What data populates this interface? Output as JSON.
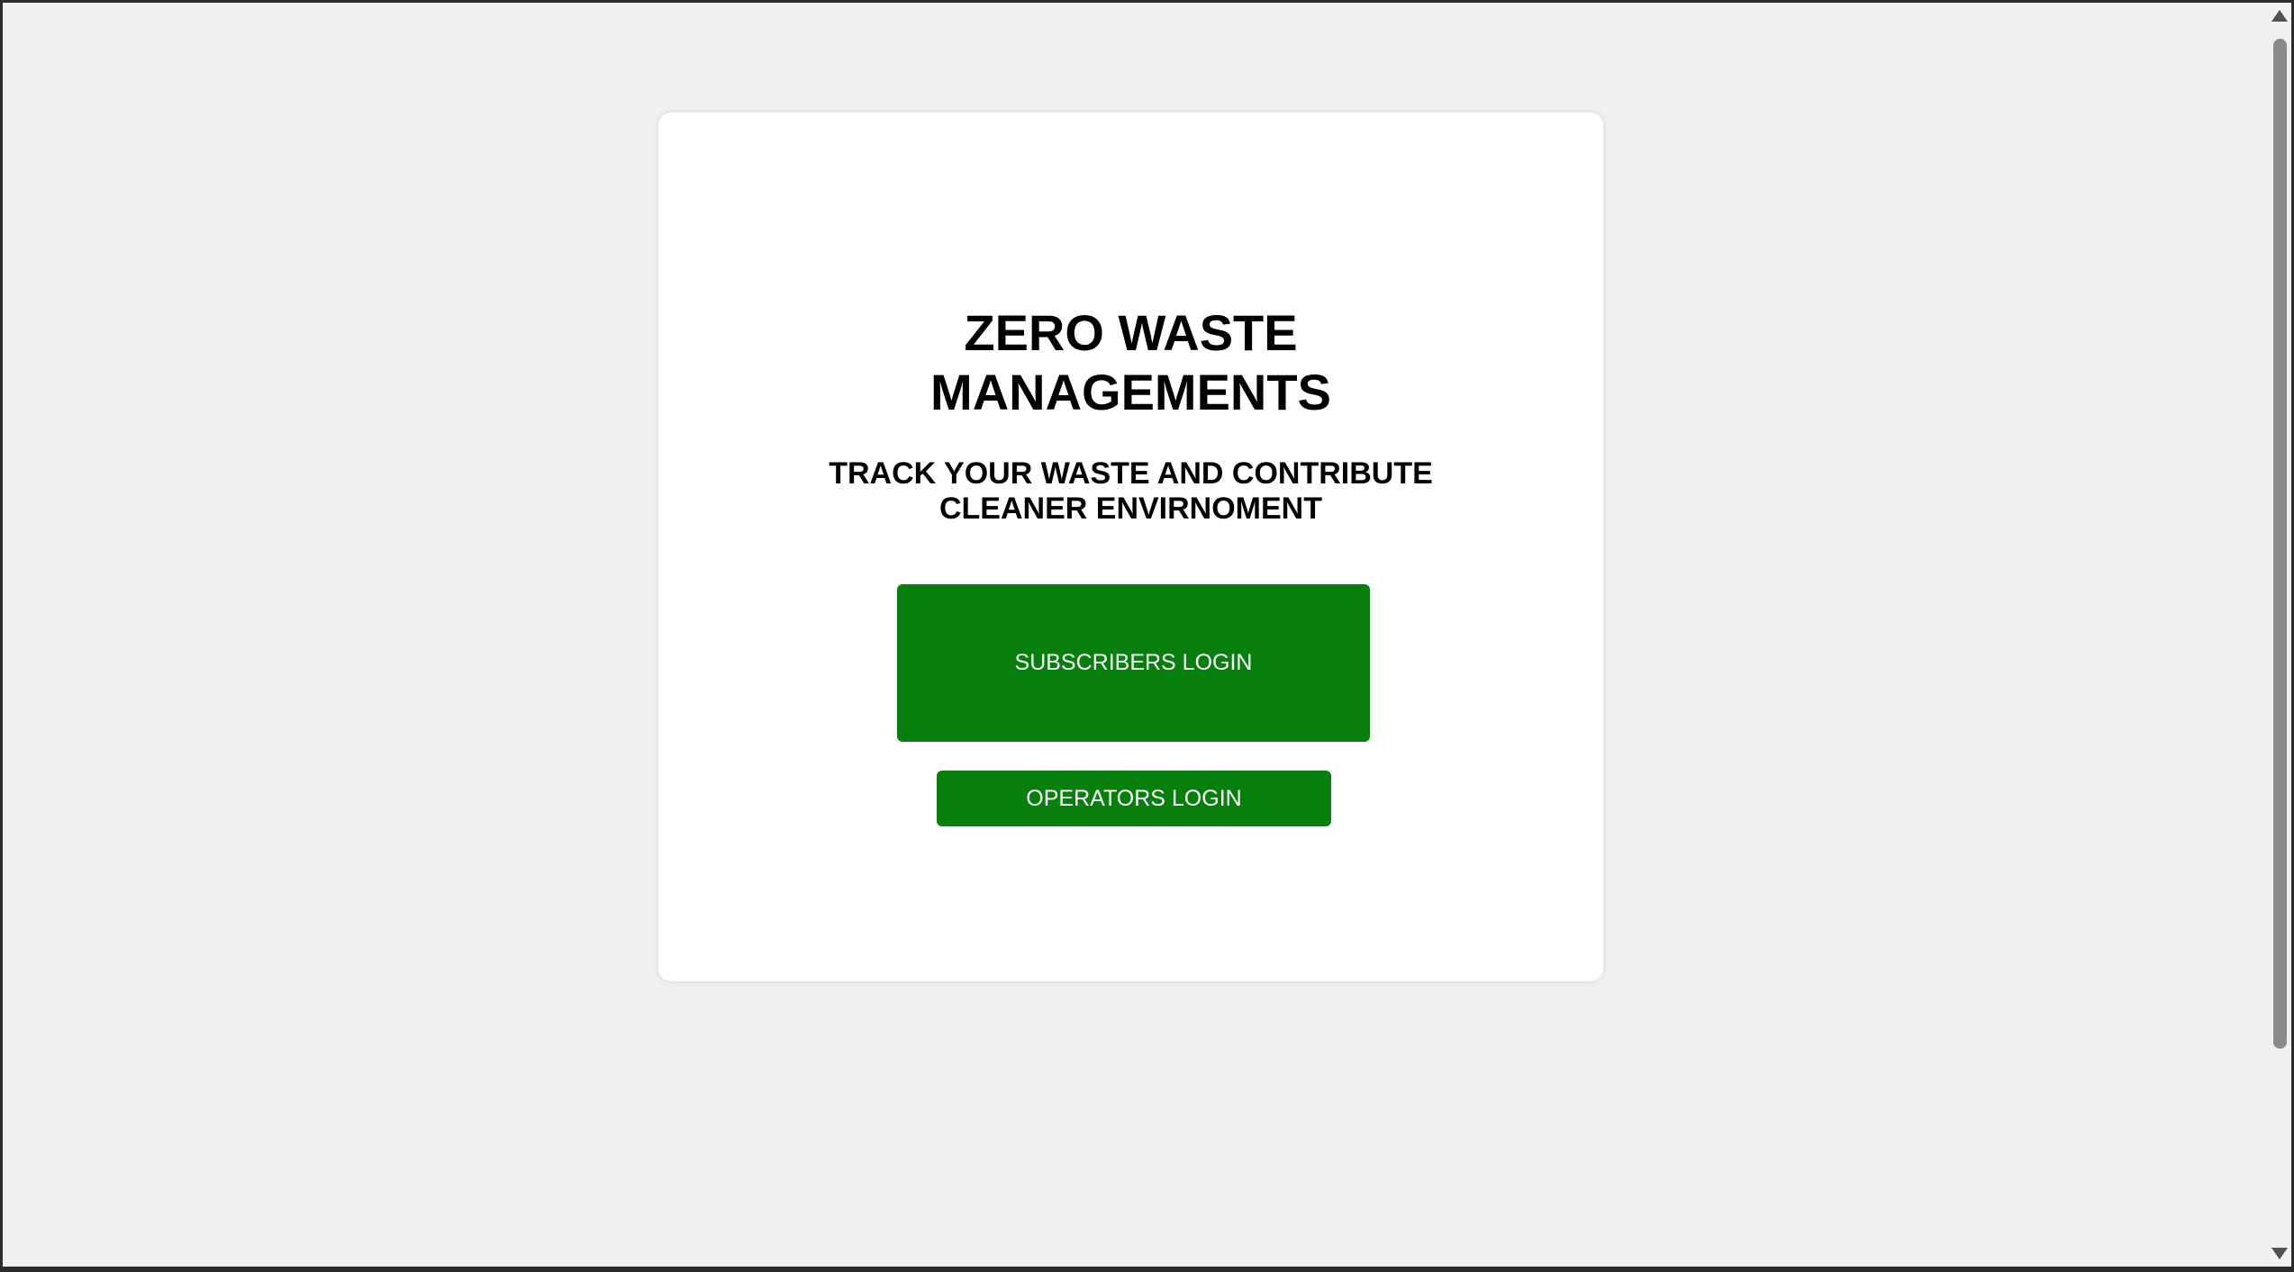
{
  "page": {
    "title_text": "ZERO WASTE MANAGEMENTS",
    "subtitle_text": "TRACK YOUR WASTE AND CONTRIBUTE CLEANER ENVIRNOMENT"
  },
  "buttons": {
    "subscribers_label": "SUBSCRIBERS LOGIN",
    "operators_label": "OPERATORS LOGIN"
  },
  "colors": {
    "accent": "#067f0d",
    "background": "#f0f0f0",
    "card": "#ffffff"
  },
  "icons": {
    "scroll_up": "triangle-up-icon",
    "scroll_down": "triangle-down-icon"
  }
}
